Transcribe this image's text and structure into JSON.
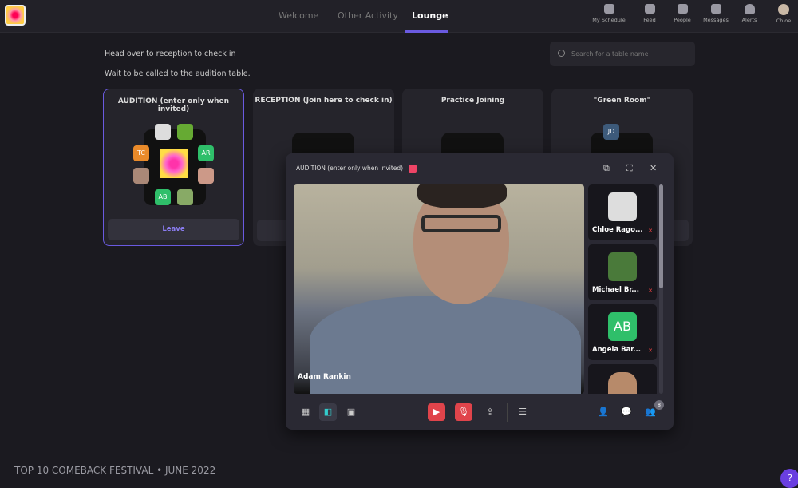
{
  "header": {
    "tabs": [
      "Welcome",
      "Other Activity",
      "Lounge"
    ],
    "active_tab": "Lounge",
    "nav": [
      {
        "label": "My Schedule",
        "icon": "calendar-icon"
      },
      {
        "label": "Feed",
        "icon": "feed-icon"
      },
      {
        "label": "People",
        "icon": "people-icon"
      },
      {
        "label": "Messages",
        "icon": "messages-icon"
      },
      {
        "label": "Alerts",
        "icon": "bell-icon"
      },
      {
        "label": "Chloe",
        "icon": "avatar"
      }
    ]
  },
  "intro": [
    "Head over to reception to check in",
    "Wait to be called to the audition table."
  ],
  "search": {
    "placeholder": "Search for a table name"
  },
  "tables": [
    {
      "title": "AUDITION (enter only when invited)",
      "button": "Leave",
      "seats": [
        "TC",
        "AR",
        "AB"
      ]
    },
    {
      "title": "RECEPTION (Join here to check in)"
    },
    {
      "title": "Practice Joining"
    },
    {
      "title": "\"Green Room\"",
      "seats": [
        "JD"
      ]
    }
  ],
  "call": {
    "title": "AUDITION (enter only when invited)",
    "main_speaker": "Adam Rankin",
    "participants": [
      {
        "name": "Chloe Rago..."
      },
      {
        "name": "Michael Br..."
      },
      {
        "name": "Angela Bar...",
        "initials": "AB"
      },
      {
        "name": ""
      }
    ],
    "participant_count": "8"
  },
  "footer": "TOP 10 COMEBACK FESTIVAL • JUNE 2022",
  "help": "?",
  "colors": {
    "accent": "#6a5ae0",
    "danger": "#e0444b",
    "green": "#2fbf6a",
    "orange": "#e98a2a"
  }
}
